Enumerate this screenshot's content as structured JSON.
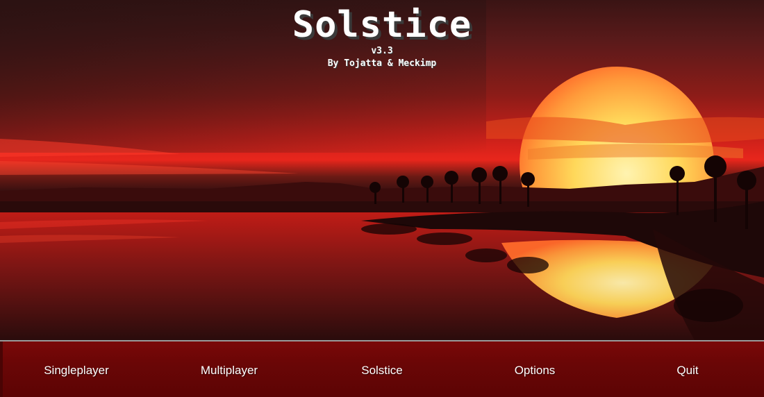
{
  "title": {
    "name": "Solstice",
    "version": "v3.3",
    "credits": "By Tojatta & Meckimp"
  },
  "menu": {
    "items": [
      {
        "label": "Singleplayer"
      },
      {
        "label": "Multiplayer"
      },
      {
        "label": "Solstice"
      },
      {
        "label": "Options"
      },
      {
        "label": "Quit"
      }
    ]
  },
  "colors": {
    "menu_bar": "#6a0606",
    "sky_red": "#e8261c",
    "sun_core": "#ffe27a",
    "text": "#ffffff"
  }
}
